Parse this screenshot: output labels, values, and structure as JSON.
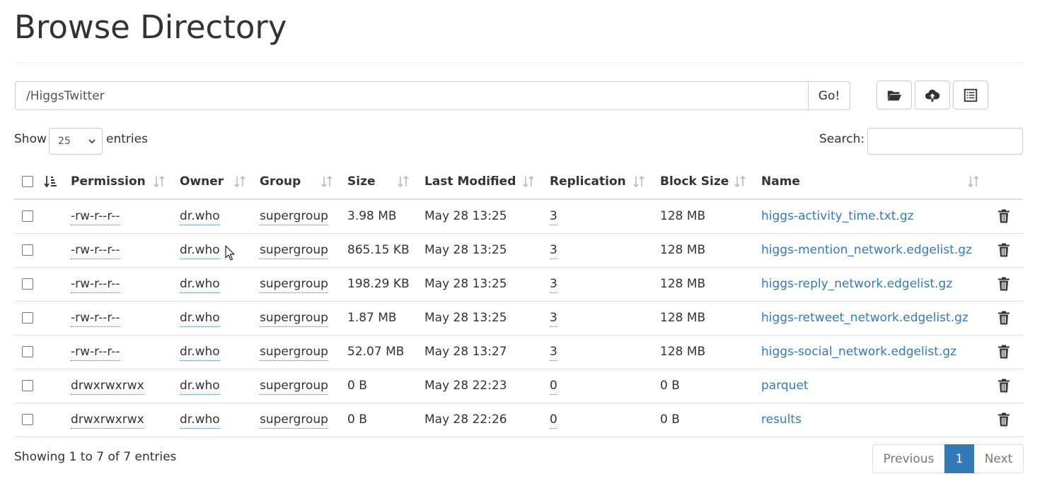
{
  "page": {
    "title": "Browse Directory"
  },
  "path": {
    "value": "/HiggsTwitter",
    "go_label": "Go!"
  },
  "toolbar": {
    "icons": [
      "folder-open-icon",
      "cloud-upload-icon",
      "list-alt-icon"
    ]
  },
  "length": {
    "show_label": "Show",
    "value": "25",
    "entries_label": "entries"
  },
  "search": {
    "label": "Search:",
    "value": ""
  },
  "table": {
    "headers": [
      "Permission",
      "Owner",
      "Group",
      "Size",
      "Last Modified",
      "Replication",
      "Block Size",
      "Name"
    ],
    "rows": [
      {
        "permission": "-rw-r--r--",
        "owner": "dr.who",
        "group": "supergroup",
        "size": "3.98 MB",
        "modified": "May 28 13:25",
        "replication": "3",
        "block_size": "128 MB",
        "name": "higgs-activity_time.txt.gz"
      },
      {
        "permission": "-rw-r--r--",
        "owner": "dr.who",
        "group": "supergroup",
        "size": "865.15 KB",
        "modified": "May 28 13:25",
        "replication": "3",
        "block_size": "128 MB",
        "name": "higgs-mention_network.edgelist.gz"
      },
      {
        "permission": "-rw-r--r--",
        "owner": "dr.who",
        "group": "supergroup",
        "size": "198.29 KB",
        "modified": "May 28 13:25",
        "replication": "3",
        "block_size": "128 MB",
        "name": "higgs-reply_network.edgelist.gz"
      },
      {
        "permission": "-rw-r--r--",
        "owner": "dr.who",
        "group": "supergroup",
        "size": "1.87 MB",
        "modified": "May 28 13:25",
        "replication": "3",
        "block_size": "128 MB",
        "name": "higgs-retweet_network.edgelist.gz"
      },
      {
        "permission": "-rw-r--r--",
        "owner": "dr.who",
        "group": "supergroup",
        "size": "52.07 MB",
        "modified": "May 28 13:27",
        "replication": "3",
        "block_size": "128 MB",
        "name": "higgs-social_network.edgelist.gz"
      },
      {
        "permission": "drwxrwxrwx",
        "owner": "dr.who",
        "group": "supergroup",
        "size": "0 B",
        "modified": "May 28 22:23",
        "replication": "0",
        "block_size": "0 B",
        "name": "parquet"
      },
      {
        "permission": "drwxrwxrwx",
        "owner": "dr.who",
        "group": "supergroup",
        "size": "0 B",
        "modified": "May 28 22:26",
        "replication": "0",
        "block_size": "0 B",
        "name": "results"
      }
    ]
  },
  "footer": {
    "info": "Showing 1 to 7 of 7 entries",
    "previous": "Previous",
    "current_page": "1",
    "next": "Next"
  },
  "colors": {
    "link": "#337ab7",
    "active_page": "#337ab7",
    "border": "#dddddd"
  }
}
